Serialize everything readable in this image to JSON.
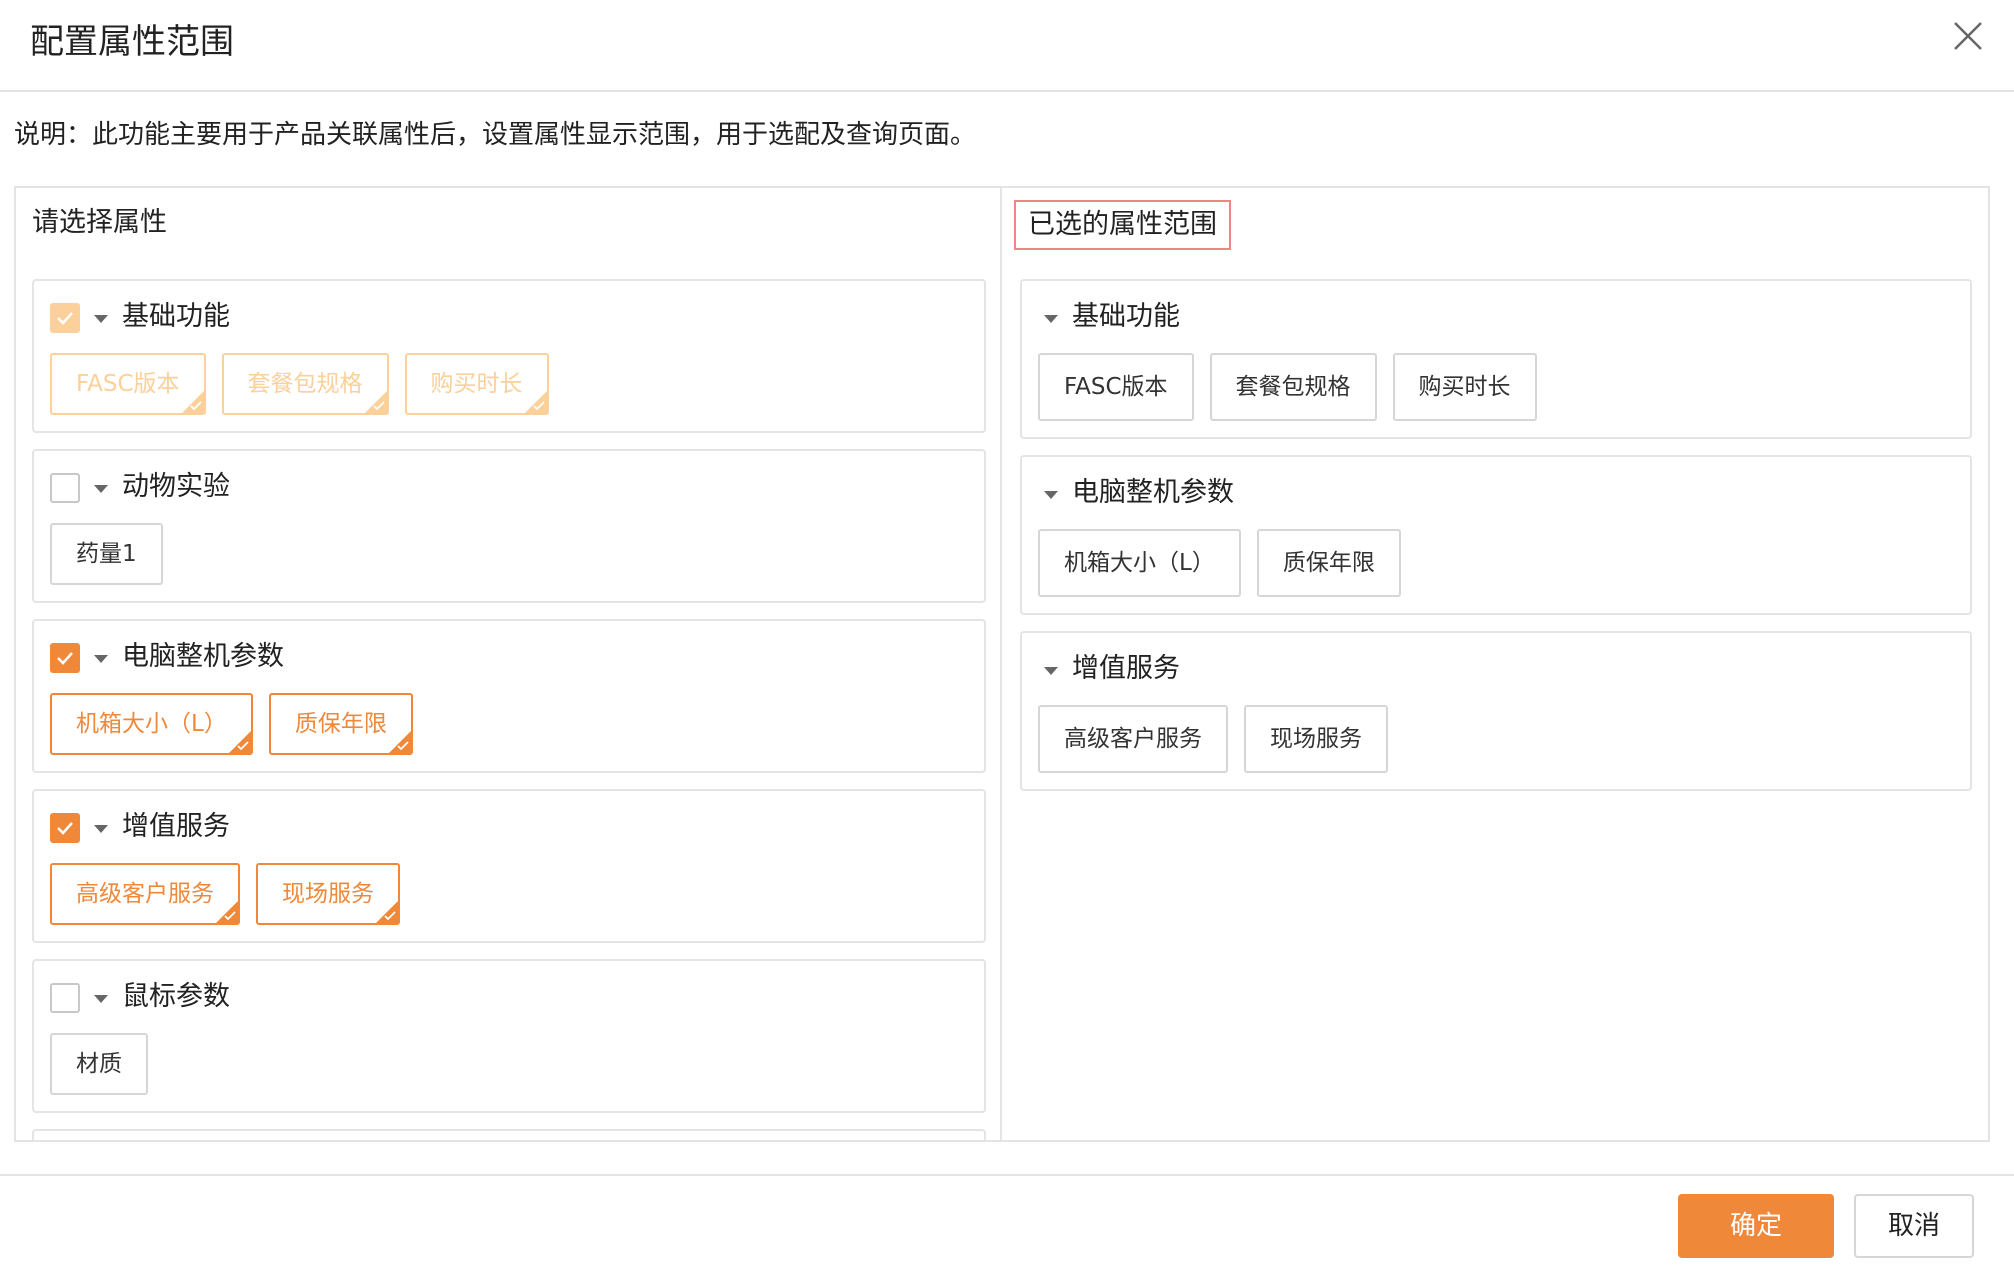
{
  "dialog": {
    "title": "配置属性范围",
    "description": "说明：此功能主要用于产品关联属性后，设置属性显示范围，用于选配及查询页面。"
  },
  "left_panel": {
    "heading": "请选择属性",
    "groups": [
      {
        "name": "基础功能",
        "checked": "disabled-checked",
        "tags": [
          "FASC版本",
          "套餐包规格",
          "购买时长"
        ]
      },
      {
        "name": "动物实验",
        "checked": "unchecked",
        "tags": [
          "药量1"
        ]
      },
      {
        "name": "电脑整机参数",
        "checked": "checked",
        "tags": [
          "机箱大小（L）",
          "质保年限"
        ]
      },
      {
        "name": "增值服务",
        "checked": "checked",
        "tags": [
          "高级客户服务",
          "现场服务"
        ]
      },
      {
        "name": "鼠标参数",
        "checked": "unchecked",
        "tags": [
          "材质"
        ]
      }
    ]
  },
  "right_panel": {
    "heading": "已选的属性范围",
    "groups": [
      {
        "name": "基础功能",
        "tags": [
          "FASC版本",
          "套餐包规格",
          "购买时长"
        ]
      },
      {
        "name": "电脑整机参数",
        "tags": [
          "机箱大小（L）",
          "质保年限"
        ]
      },
      {
        "name": "增值服务",
        "tags": [
          "高级客户服务",
          "现场服务"
        ]
      }
    ]
  },
  "footer": {
    "confirm_label": "确定",
    "cancel_label": "取消"
  },
  "colors": {
    "accent": "#f0883a",
    "accent_light": "#fbd09a",
    "highlight_border": "#f08585"
  }
}
